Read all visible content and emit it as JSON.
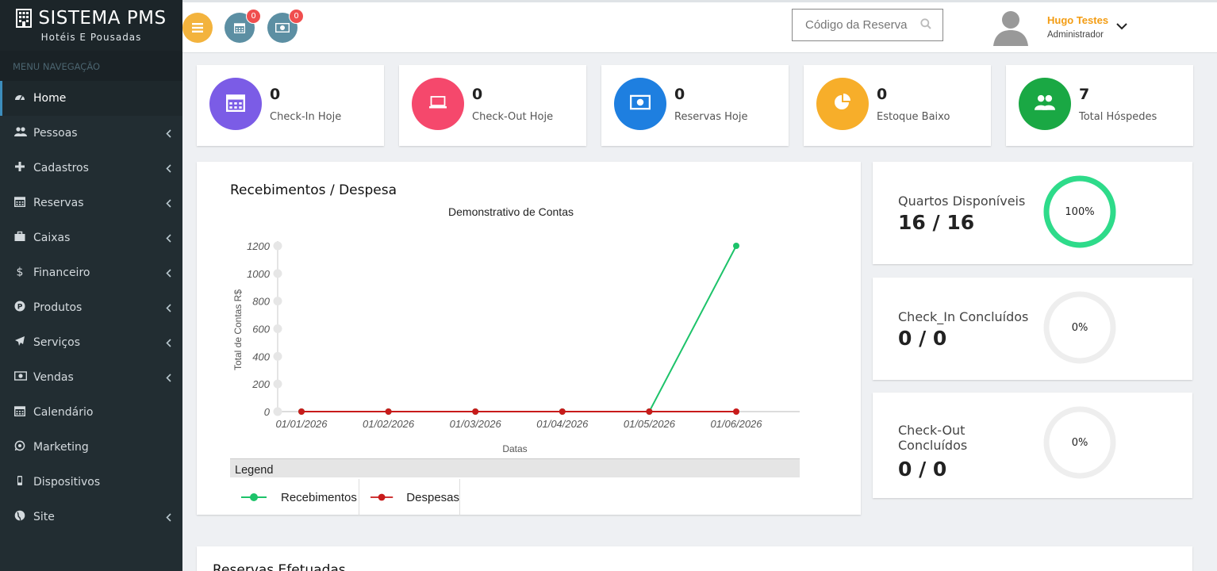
{
  "brand": {
    "title": "SISTEMA PMS",
    "subtitle": "Hotéis E Pousadas"
  },
  "sidebar": {
    "header": "MENU NAVEGAÇÃO",
    "items": [
      {
        "label": "Home",
        "icon": "dashboard-icon",
        "active": true,
        "submenu": false
      },
      {
        "label": "Pessoas",
        "icon": "users-icon",
        "submenu": true
      },
      {
        "label": "Cadastros",
        "icon": "plus-icon",
        "submenu": true
      },
      {
        "label": "Reservas",
        "icon": "calendar-icon",
        "submenu": true
      },
      {
        "label": "Caixas",
        "icon": "briefcase-icon",
        "submenu": true
      },
      {
        "label": "Financeiro",
        "icon": "dollar-icon",
        "submenu": true
      },
      {
        "label": "Produtos",
        "icon": "product-icon",
        "submenu": true
      },
      {
        "label": "Serviços",
        "icon": "plane-icon",
        "submenu": true
      },
      {
        "label": "Vendas",
        "icon": "money-icon",
        "submenu": true
      },
      {
        "label": "Calendário",
        "icon": "calendar-icon",
        "submenu": false
      },
      {
        "label": "Marketing",
        "icon": "whatsapp-icon",
        "submenu": false
      },
      {
        "label": "Dispositivos",
        "icon": "mobile-icon",
        "submenu": false
      },
      {
        "label": "Site",
        "icon": "globe-icon",
        "submenu": true
      }
    ]
  },
  "header": {
    "calendar_badge": "0",
    "money_badge": "0",
    "search_placeholder": "Código da Reserva",
    "user_name": "Hugo Testes",
    "user_role": "Administrador"
  },
  "stats": [
    {
      "value": "0",
      "label": "Check-In Hoje",
      "color": "#7b5ce6",
      "icon": "calendar-icon"
    },
    {
      "value": "0",
      "label": "Check-Out Hoje",
      "color": "#f5486c",
      "icon": "laptop-icon"
    },
    {
      "value": "0",
      "label": "Reservas Hoje",
      "color": "#1e7fe0",
      "icon": "money-icon"
    },
    {
      "value": "0",
      "label": "Estoque Baixo",
      "color": "#f7ae2a",
      "icon": "pie-chart-icon"
    },
    {
      "value": "7",
      "label": "Total Hóspedes",
      "color": "#1aa844",
      "icon": "users-icon"
    }
  ],
  "chart_panel": {
    "title": "Recebimentos / Despesa",
    "legend_title": "Legend"
  },
  "chart_data": {
    "type": "line",
    "title": "Demonstrativo de Contas",
    "xlabel": "Datas",
    "ylabel": "Total de Contas R$",
    "categories": [
      "01/01/2026",
      "01/02/2026",
      "01/03/2026",
      "01/04/2026",
      "01/05/2026",
      "01/06/2026"
    ],
    "yticks": [
      0,
      200,
      400,
      600,
      800,
      1000,
      1200
    ],
    "ylim": [
      0,
      1200
    ],
    "series": [
      {
        "name": "Recebimentos",
        "color": "#1dc36a",
        "values": [
          0,
          0,
          0,
          0,
          0,
          1200
        ]
      },
      {
        "name": "Despesas",
        "color": "#c81b1b",
        "values": [
          0,
          0,
          0,
          0,
          0,
          0
        ]
      }
    ]
  },
  "right_panels": [
    {
      "label": "Quartos Disponíveis",
      "value": "16 / 16",
      "percent": "100%",
      "fraction": 1.0,
      "color": "#2edb8a"
    },
    {
      "label": "Check_In Concluídos",
      "value": "0 / 0",
      "percent": "0%",
      "fraction": 0.0,
      "color": "#2edb8a"
    },
    {
      "label": "Check-Out Concluídos",
      "value": "0 / 0",
      "percent": "0%",
      "fraction": 0.0,
      "color": "#2edb8a"
    }
  ],
  "bottom_panel": {
    "title": "Reservas Efetuadas"
  }
}
